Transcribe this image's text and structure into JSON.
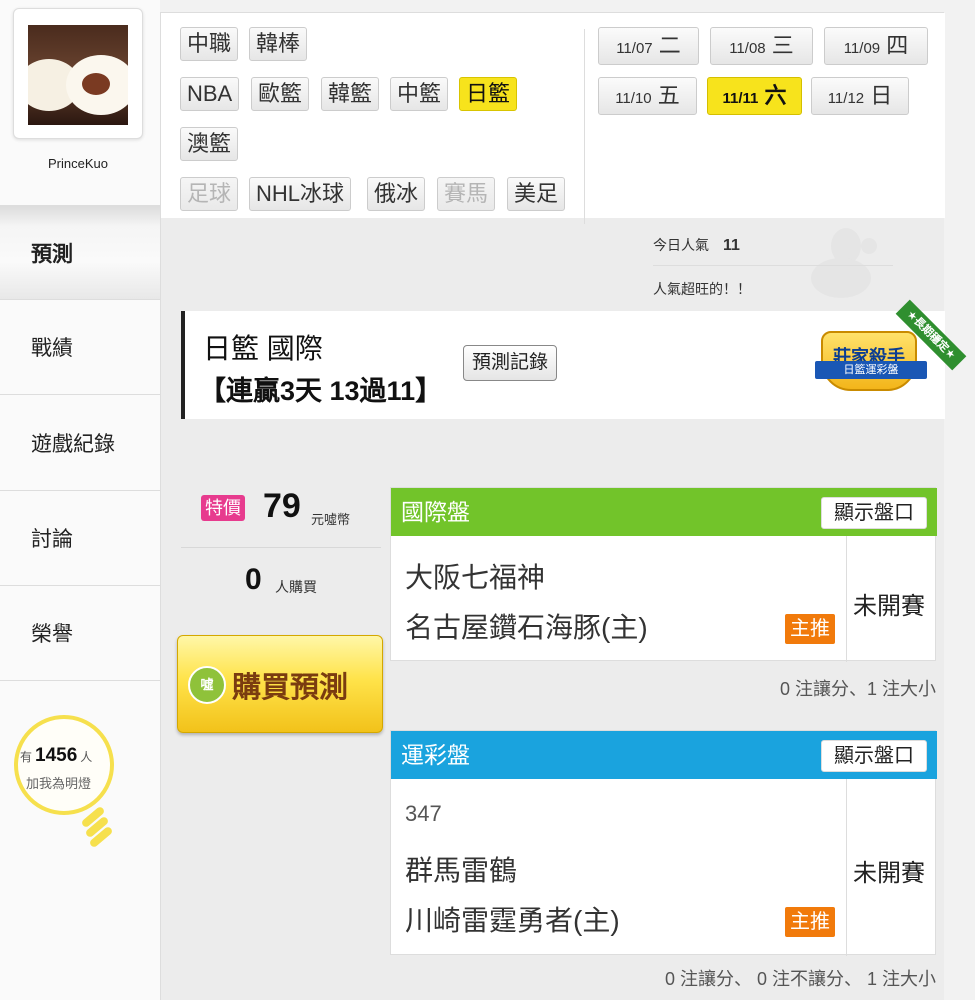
{
  "user": {
    "name": "PrinceKuo"
  },
  "nav": {
    "predict": "預測",
    "record": "戰績",
    "games": "遊戲紀錄",
    "discuss": "討論",
    "honor": "榮譽"
  },
  "fans": {
    "prefix": "有",
    "count": "1456",
    "suffix": "人",
    "label": "加我為明燈"
  },
  "sports": {
    "row1": [
      "中職",
      "韓棒"
    ],
    "row2": [
      "NBA",
      "歐籃",
      "韓籃",
      "中籃",
      "日籃"
    ],
    "row3": [
      "澳籃"
    ],
    "row4": [
      "足球",
      "NHL冰球",
      "俄冰",
      "賽馬",
      "美足"
    ],
    "active": "日籃",
    "disabled": [
      "足球",
      "賽馬"
    ]
  },
  "dates": [
    {
      "md": "11/07",
      "dow": "二",
      "active": false
    },
    {
      "md": "11/08",
      "dow": "三",
      "active": false
    },
    {
      "md": "11/09",
      "dow": "四",
      "active": false
    },
    {
      "md": "11/10",
      "dow": "五",
      "active": false
    },
    {
      "md": "11/11",
      "dow": "六",
      "active": true
    },
    {
      "md": "11/12",
      "dow": "日",
      "active": false
    }
  ],
  "popularity": {
    "label": "今日人氣",
    "value": "11",
    "message": "人氣超旺的！！"
  },
  "header": {
    "title": "日籃 國際",
    "streak": "【連贏3天 13過11】",
    "record_button": "預測記錄",
    "badge_ribbon": "★長期穩定★",
    "badge_title": "莊家殺手",
    "badge_sub": "日籃運彩盤"
  },
  "purchase": {
    "special_tag": "特價",
    "price": "79",
    "price_unit": "元噓幣",
    "buyers": "0",
    "buyers_unit": "人購買",
    "buy_button": "購買預測",
    "buy_icon": "噓"
  },
  "games": [
    {
      "header": "國際盤",
      "show_button": "顯示盤口",
      "game_no": "",
      "away": "大阪七福神",
      "home": "名古屋鑽石海豚(主)",
      "pick_tag": "主推",
      "status": "未開賽",
      "note": "0 注讓分、1 注大小",
      "header_color": "#72c42a"
    },
    {
      "header": "運彩盤",
      "show_button": "顯示盤口",
      "game_no": "347",
      "away": "群馬雷鶴",
      "home": "川崎雷霆勇者(主)",
      "pick_tag": "主推",
      "status": "未開賽",
      "note": "0 注讓分、 0 注不讓分、 1 注大小",
      "header_color": "#1aa3de"
    }
  ],
  "colors": {
    "active_yellow": "#f7e31c",
    "special_pink": "#e73b8e",
    "pick_orange": "#f17a0b",
    "bulb_yellow": "#f6e04d"
  }
}
